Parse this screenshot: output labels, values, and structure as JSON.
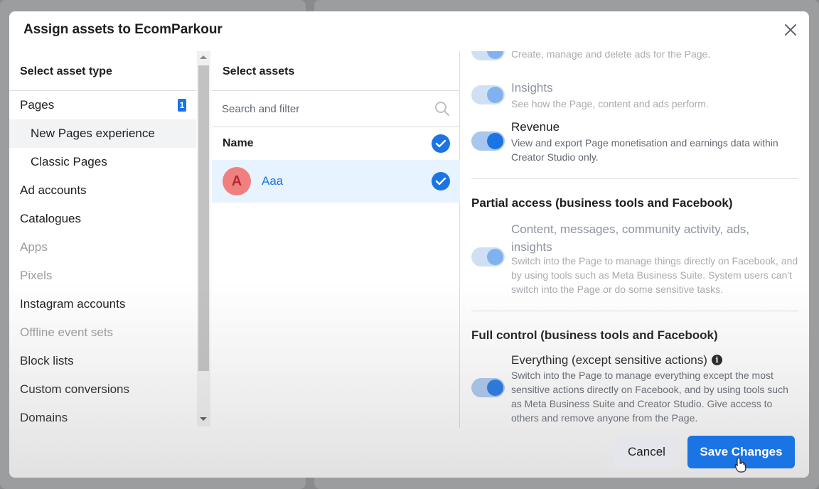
{
  "modal": {
    "title": "Assign assets to EcomParkour"
  },
  "asset_types": {
    "heading": "Select asset type",
    "items": [
      {
        "label": "Pages",
        "badge": "1",
        "state": "normal"
      },
      {
        "label": "New Pages experience",
        "state": "active",
        "sub": true
      },
      {
        "label": "Classic Pages",
        "state": "normal",
        "sub": true
      },
      {
        "label": "Ad accounts",
        "state": "normal"
      },
      {
        "label": "Catalogues",
        "state": "normal"
      },
      {
        "label": "Apps",
        "state": "disabled"
      },
      {
        "label": "Pixels",
        "state": "disabled"
      },
      {
        "label": "Instagram accounts",
        "state": "normal"
      },
      {
        "label": "Offline event sets",
        "state": "disabled"
      },
      {
        "label": "Block lists",
        "state": "normal"
      },
      {
        "label": "Custom conversions",
        "state": "normal"
      },
      {
        "label": "Domains",
        "state": "normal"
      }
    ]
  },
  "assets": {
    "heading": "Select assets",
    "search_placeholder": "Search and filter",
    "column_name": "Name",
    "rows": [
      {
        "avatar_letter": "A",
        "name": "Aaa",
        "selected": true
      }
    ]
  },
  "permissions": {
    "top_partial_desc": "Create, manage and delete ads for the Page.",
    "insights": {
      "title": "Insights",
      "desc": "See how the Page, content and ads perform."
    },
    "revenue": {
      "title": "Revenue",
      "desc": "View and export Page monetisation and earnings data within Creator Studio only."
    },
    "partial_access": {
      "heading": "Partial access (business tools and Facebook)",
      "title": "Content, messages, community activity, ads, insights",
      "desc": "Switch into the Page to manage things directly on Facebook, and by using tools such as Meta Business Suite. System users can't switch into the Page or do some sensitive tasks."
    },
    "full_control": {
      "heading": "Full control (business tools and Facebook)",
      "title": "Everything (except sensitive actions)",
      "desc": "Switch into the Page to manage everything except the most sensitive actions directly on Facebook, and by using tools such as Meta Business Suite and Creator Studio. Give access to others and remove anyone from the Page."
    }
  },
  "footer": {
    "cancel_label": "Cancel",
    "save_label": "Save Changes"
  },
  "colors": {
    "accent": "#1b74e4",
    "selected_row": "#e7f3ff"
  },
  "icons": [
    "close-icon",
    "search-icon",
    "check-icon",
    "info-icon",
    "pointer-cursor-icon"
  ]
}
